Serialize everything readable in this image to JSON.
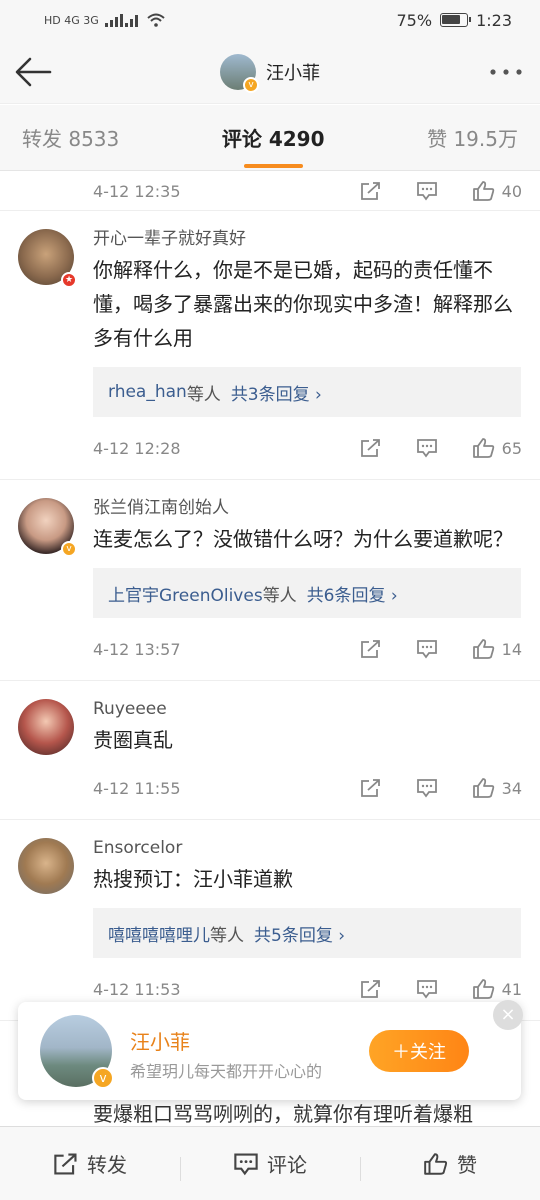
{
  "status": {
    "left_glyphs": "HD 4G 3G",
    "battery": "75%",
    "time": "1:23"
  },
  "header": {
    "title": "汪小菲"
  },
  "tabs": {
    "repost": "转发 8533",
    "comment": "评论 4290",
    "like": "赞 19.5万"
  },
  "top_footer": {
    "time": "4-12 12:35",
    "likes": "40"
  },
  "comments": [
    {
      "name": "开心一辈子就好真好",
      "text": "你解释什么，你是不是已婚，起码的责任懂不懂，喝多了暴露出来的你现实中多渣！解释那么多有什么用",
      "reply_who": "rhea_han",
      "reply_etc": "等人",
      "reply_count": "共3条回复 ›",
      "time": "4-12 12:28",
      "likes": "65"
    },
    {
      "name": "张兰俏江南创始人",
      "text": "连麦怎么了？没做错什么呀？为什么要道歉呢？",
      "reply_who": "上官宇GreenOlives",
      "reply_etc": "等人",
      "reply_count": "共6条回复 ›",
      "time": "4-12 13:57",
      "likes": "14"
    },
    {
      "name": "Ruyeeee",
      "text": "贵圈真乱",
      "time": "4-12 11:55",
      "likes": "34"
    },
    {
      "name": "Ensorcelor",
      "text": "热搜预订：汪小菲道歉",
      "reply_who": "嘻嘻嘻嘻哩儿",
      "reply_etc": "等人",
      "reply_count": "共5条回复 ›",
      "time": "4-12 11:53",
      "likes": "41"
    }
  ],
  "follow_card": {
    "name": "汪小菲",
    "subtitle": "希望玥儿每天都开开心心的",
    "follow_label": "＋关注"
  },
  "behind_text": "要爆粗口骂骂咧咧的，就算你有理听着爆粗",
  "bottom_bar": {
    "repost": "转发",
    "comment": "评论",
    "like": "赞"
  },
  "colors": {
    "accent": "#f78c1e",
    "link": "#3b5d8f"
  }
}
